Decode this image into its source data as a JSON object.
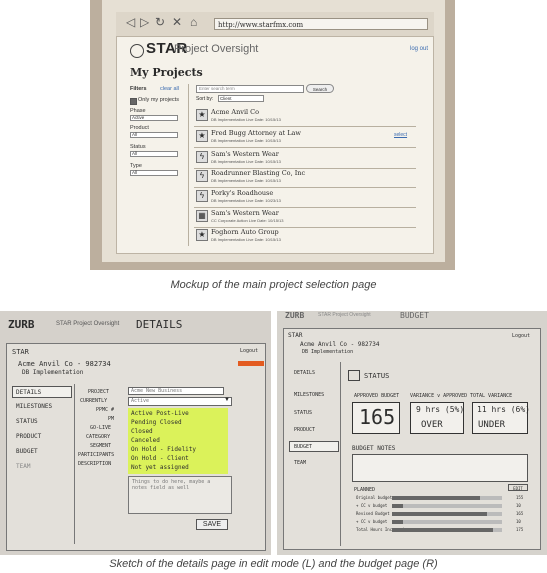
{
  "mockup": {
    "url": "http://www.starfmx.com",
    "logo_brand": "STAR",
    "logo_sub": "Project Oversight",
    "logout": "log out",
    "heading": "My Projects",
    "filters_label": "Filters",
    "clear_all": "clear all",
    "only_my_projects": "Only my projects",
    "filter_groups": [
      {
        "label": "Phase",
        "value": "Active"
      },
      {
        "label": "Product",
        "value": "All"
      },
      {
        "label": "Status",
        "value": "All"
      },
      {
        "label": "Type",
        "value": "All"
      }
    ],
    "search_placeholder": "Enter search term",
    "search_button": "Search",
    "sort_by": "Sort by:",
    "sort_value": "Client",
    "select_link": "select",
    "projects": [
      {
        "icon": "star",
        "name": "Acme Anvil Co",
        "meta": "DB Implementation  Live Date: 10/15/13"
      },
      {
        "icon": "star",
        "name": "Fred Bugg Attorney at Law",
        "meta": "DB Implementation  Live Date: 10/15/13"
      },
      {
        "icon": "bolt",
        "name": "Sam's Western Wear",
        "meta": "DB Implementation  Live Date: 10/15/13"
      },
      {
        "icon": "bolt",
        "name": "Roadrunner Blasting Co, Inc",
        "meta": "DB Implementation  Live Date: 10/15/13"
      },
      {
        "icon": "bolt",
        "name": "Porky's Roadhouse",
        "meta": "DB Implementation  Live Date: 10/23/13"
      },
      {
        "icon": "grid",
        "name": "Sam's Western Wear",
        "meta": "CC Corporate Action  Live Date: 10/15/13"
      },
      {
        "icon": "star",
        "name": "Foghorn Auto Group",
        "meta": "DB Implementation  Live Date: 10/15/13"
      }
    ]
  },
  "captions": {
    "top": "Mockup of the main project selection page",
    "bottom": "Sketch of the details page in edit mode (L) and the budget page (R)"
  },
  "left_sketch": {
    "zurb": "ZURB",
    "app": "STAR Project Oversight",
    "section": "DETAILS",
    "star": "STAR",
    "logout": "Logout",
    "client": "Acme Anvil Co - 982734",
    "client_sub": "DB Implementation",
    "nav": [
      "DETAILS",
      "MILESTONES",
      "STATUS",
      "PRODUCT",
      "BUDGET",
      "TEAM"
    ],
    "fields": [
      "PROJECT",
      "CURRENTLY",
      "PPMC #",
      "PM",
      "GO-LIVE",
      "CATEGORY",
      "SEGMENT",
      "PARTICIPANTS",
      "DESCRIPTION"
    ],
    "project_value": "Acme New Business",
    "dropdown_value": "Active",
    "options": [
      "Active Post-Live",
      "Pending Closed",
      "Closed",
      "Canceled",
      "On Hold - Fidelity",
      "On Hold - Client",
      "Not yet assigned"
    ],
    "note": "Things to do here, maybe a notes field as well",
    "save": "SAVE"
  },
  "right_sketch": {
    "zurb": "ZURB",
    "app": "STAR Project Oversight",
    "section": "BUDGET",
    "star": "STAR",
    "logout": "Logout",
    "client": "Acme Anvil Co - 982734",
    "client_sub": "DB Implementation",
    "nav": [
      "DETAILS",
      "MILESTONES",
      "STATUS",
      "PRODUCT",
      "BUDGET",
      "TEAM"
    ],
    "status_title": "STATUS",
    "col_headers": [
      "APPROVED BUDGET",
      "VARIANCE v APPROVED",
      "TOTAL VARIANCE"
    ],
    "approved": "165",
    "variance": "9 hrs (5%)",
    "variance_word": "OVER",
    "total": "11 hrs (6%)",
    "total_word": "UNDER",
    "budget_notes": "BUDGET NOTES",
    "planned": "PLANNED",
    "edit": "EDIT",
    "rows": [
      {
        "label": "Original budget",
        "value": "155",
        "frac": 0.8
      },
      {
        "label": "+ CC v budget",
        "value": "10",
        "frac": 0.1
      },
      {
        "label": "Revised Budget",
        "value": "165",
        "frac": 0.86
      },
      {
        "label": "+ CC v budget",
        "value": "10",
        "frac": 0.1
      },
      {
        "label": "Total Hours Incurred",
        "value": "175",
        "frac": 0.92
      }
    ]
  }
}
